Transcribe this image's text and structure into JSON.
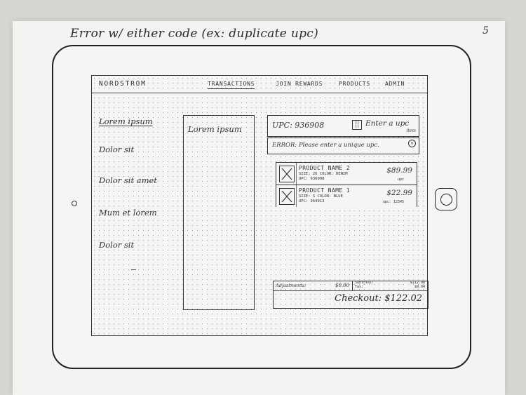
{
  "annotation": {
    "caption": "Error w/ either code (ex: duplicate upc)",
    "page_number": "5"
  },
  "nav": {
    "brand": "NORDSTROM",
    "items": [
      {
        "label": "TRANSACTIONS",
        "active": true
      },
      {
        "label": "JOIN REWARDS",
        "active": false
      },
      {
        "label": "PRODUCTS",
        "active": false
      },
      {
        "label": "ADMIN",
        "active": false
      }
    ]
  },
  "sidebar": {
    "heading": "Lorem ipsum",
    "items": [
      "Dolor sit",
      "Dolor sit amet",
      "Mum et lorem",
      "Dolor sit"
    ]
  },
  "panel": {
    "title": "Lorem ipsum"
  },
  "upc_entry": {
    "current_upc": "UPC: 936908",
    "scan_icon_text": "||| |||",
    "placeholder": "Enter a upc",
    "hint": "item"
  },
  "error": {
    "message": "ERROR: Please enter a unique upc.",
    "close_symbol": "×"
  },
  "products": [
    {
      "name": "PRODUCT NAME 2",
      "details": [
        "SIZE: 26  COLOR: DENIM",
        "UPC: 936908"
      ],
      "price": "$89.99",
      "extra": "upc"
    },
    {
      "name": "PRODUCT NAME 1",
      "details": [
        "SIZE: S  COLOR: BLUE",
        "UPC: 364913"
      ],
      "price": "$22.99",
      "extra": "upc: 12345"
    }
  ],
  "summary": {
    "adjustments_label": "Adjustments:",
    "adjustments_value": "$0.00",
    "subtotal_label": "Subtotal:",
    "tax_label": "Tax:",
    "subtotal_value": "$112.98",
    "tax_value": "$9.04",
    "checkout_label": "Checkout: $122.02"
  }
}
